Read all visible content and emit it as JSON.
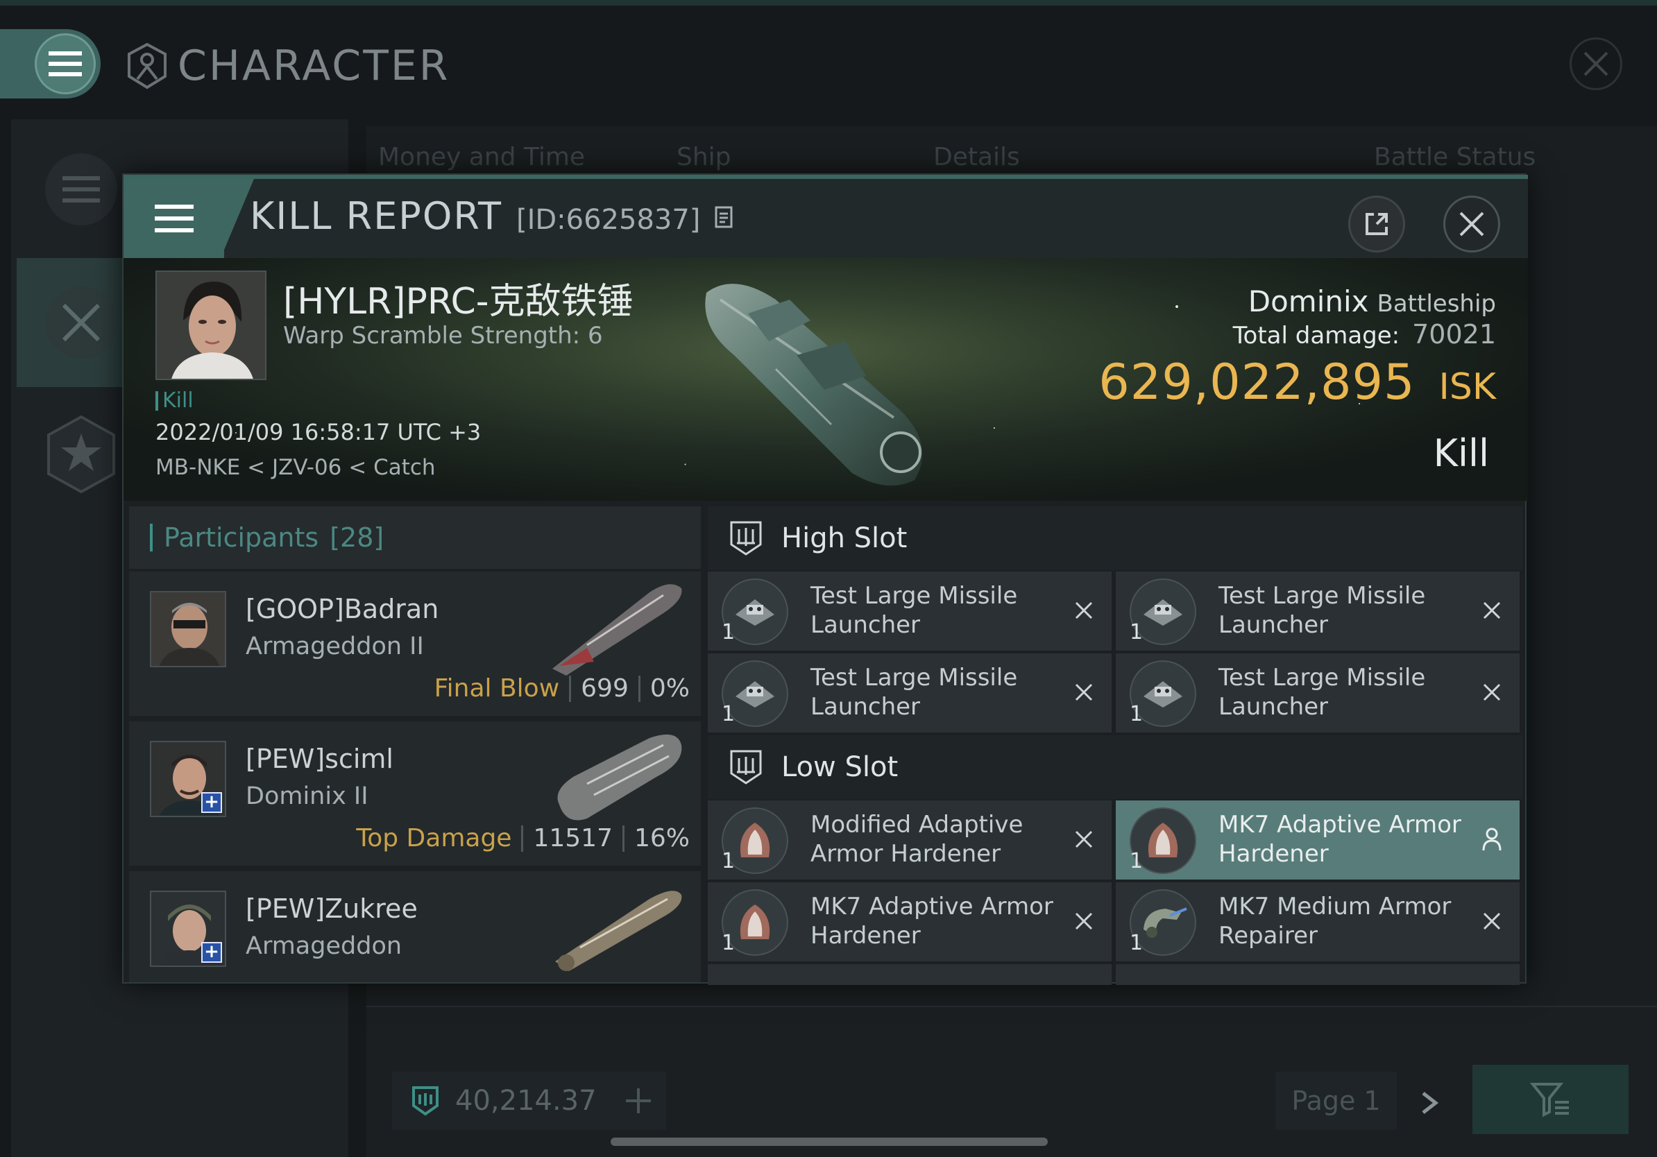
{
  "app": {
    "title": "CHARACTER",
    "tabs": [
      "Money and Time",
      "Ship",
      "Details",
      "Battle Status"
    ],
    "currency_value": "40,214.37",
    "page_label": "Page 1"
  },
  "report": {
    "title": "KILL REPORT",
    "id_text": "[ID:6625837]",
    "victim": {
      "name": "[HYLR]PRC-克敌铁锤",
      "warp_scramble": "Warp Scramble Strength: 6",
      "kill_tag": "Kill",
      "datetime": "2022/01/09 16:58:17 UTC +3",
      "location": "MB-NKE < JZV-06 < Catch"
    },
    "ship": {
      "name": "Dominix",
      "class": "Battleship",
      "total_damage_label": "Total damage:",
      "total_damage": "70021",
      "isk_value": "629,022,895",
      "isk_unit": "ISK",
      "status": "Kill"
    },
    "participants_label": "Participants",
    "participants_count": "[28]",
    "participants": [
      {
        "name": "[GOOP]Badran",
        "ship": "Armageddon II",
        "tag": "Final Blow",
        "damage": "699",
        "percent": "0%",
        "has_plus": false
      },
      {
        "name": "[PEW]sciml",
        "ship": "Dominix II",
        "tag": "Top Damage",
        "damage": "11517",
        "percent": "16%",
        "has_plus": true
      },
      {
        "name": "[PEW]Zukree",
        "ship": "Armageddon",
        "has_plus": true
      }
    ],
    "high_slot_label": "High Slot",
    "low_slot_label": "Low Slot",
    "high_slots": [
      {
        "qty": "1",
        "name": "Test Large Missile Launcher",
        "state": "destroyed"
      },
      {
        "qty": "1",
        "name": "Test Large Missile Launcher",
        "state": "destroyed"
      },
      {
        "qty": "1",
        "name": "Test Large Missile Launcher",
        "state": "destroyed"
      },
      {
        "qty": "1",
        "name": "Test Large Missile Launcher",
        "state": "destroyed"
      }
    ],
    "low_slots": [
      {
        "qty": "1",
        "name": "Modified Adaptive Armor Hardener",
        "state": "destroyed"
      },
      {
        "qty": "1",
        "name": "MK7 Adaptive Armor Hardener",
        "state": "dropped"
      },
      {
        "qty": "1",
        "name": "MK7 Adaptive Armor Hardener",
        "state": "destroyed"
      },
      {
        "qty": "1",
        "name": "MK7 Medium Armor Repairer",
        "state": "destroyed"
      }
    ]
  },
  "colors": {
    "accent": "#3f8f87",
    "isk_gold": "#e9b651",
    "tag_gold": "#c9a24a",
    "selected_row": "#587c79",
    "player_plus": "#2852a6"
  }
}
